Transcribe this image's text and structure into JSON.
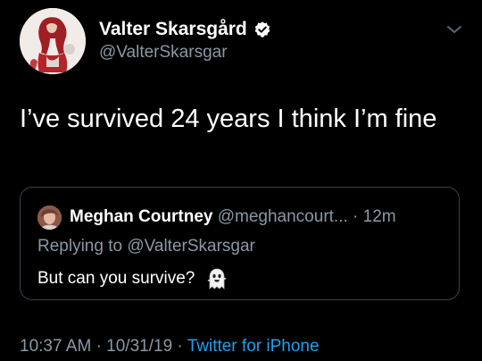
{
  "tweet": {
    "author": {
      "name": "Valter Skarsgård",
      "handle": "@ValterSkarsgar",
      "verified": true
    },
    "text": "I’ve survived 24 years I think I’m fine",
    "quoted": {
      "name": "Meghan Courtney",
      "handle": "@meghancourt...",
      "separator": "·",
      "time": "12m",
      "replying_to": "Replying to @ValterSkarsgar",
      "text": "But can you survive?",
      "emoji_icon": "ghost-icon"
    },
    "time": "10:37 AM",
    "separator": "·",
    "date": "10/31/19",
    "source": "Twitter for iPhone"
  },
  "colors": {
    "background": "#000000",
    "secondary_text": "#8b98a5",
    "link": "#1da1f2",
    "border": "#38444d",
    "verified_badge": "#ffffff"
  },
  "icons": {
    "verified": "verified-badge-icon",
    "menu": "chevron-down-icon",
    "ghost": "ghost-icon"
  }
}
